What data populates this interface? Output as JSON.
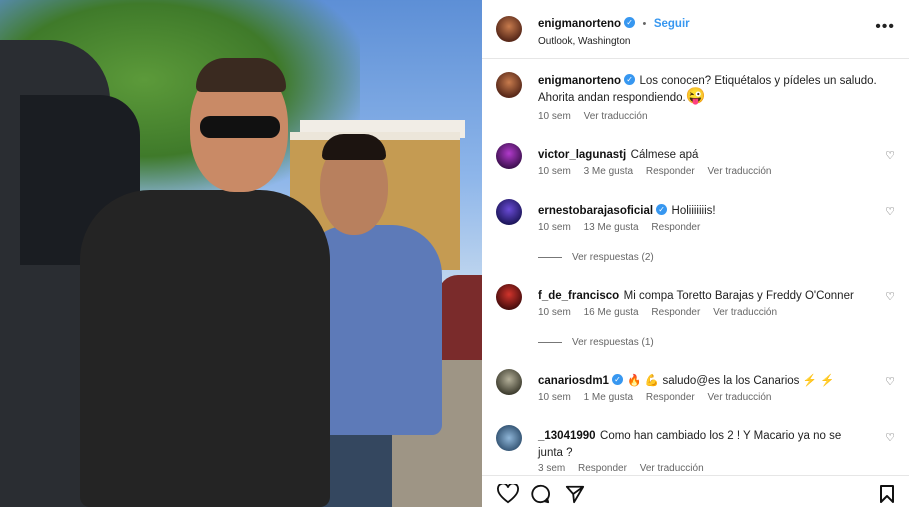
{
  "post": {
    "username": "enigmanorteno",
    "follow_label": "Seguir",
    "location": "Outlook, Washington",
    "more_icon": "more-horizontal-icon"
  },
  "caption": {
    "username": "enigmanorteno",
    "text": "Los conocen? Etiquétalos y pídeles un saludo. Ahorita andan respondiendo.",
    "emoji": "😜",
    "time": "10 sem",
    "translate_label": "Ver traducción"
  },
  "comments": [
    {
      "username": "victor_lagunastj",
      "verified": false,
      "text": "Cálmese apá",
      "time": "10 sem",
      "likes": "3 Me gusta",
      "reply": "Responder",
      "translate": "Ver traducción"
    },
    {
      "username": "ernestobarajasoficial",
      "verified": true,
      "text": "Holiiiiiiis!",
      "time": "10 sem",
      "likes": "13 Me gusta",
      "reply": "Responder",
      "replies": "Ver respuestas (2)"
    },
    {
      "username": "f_de_francisco",
      "verified": false,
      "text": "Mi compa Toretto Barajas y Freddy O'Conner",
      "time": "10 sem",
      "likes": "16 Me gusta",
      "reply": "Responder",
      "translate": "Ver traducción",
      "replies": "Ver respuestas (1)"
    },
    {
      "username": "canariosdm1",
      "verified": true,
      "text_prefix": "🔥 💪 ",
      "text": "saludo@es la los Canarios",
      "text_suffix": " ⚡ ⚡",
      "time": "10 sem",
      "likes": "1 Me gusta",
      "reply": "Responder",
      "translate": "Ver traducción"
    },
    {
      "username": "_13041990",
      "verified": false,
      "text": "Como han cambiado los 2 ! Y Macario ya no se junta ?",
      "time": "3 sem",
      "reply": "Responder",
      "translate": "Ver traducción"
    }
  ],
  "icons": {
    "like": "heart-icon",
    "comment": "comment-icon",
    "share": "send-icon",
    "save": "bookmark-icon",
    "verified": "verified-badge-icon"
  }
}
